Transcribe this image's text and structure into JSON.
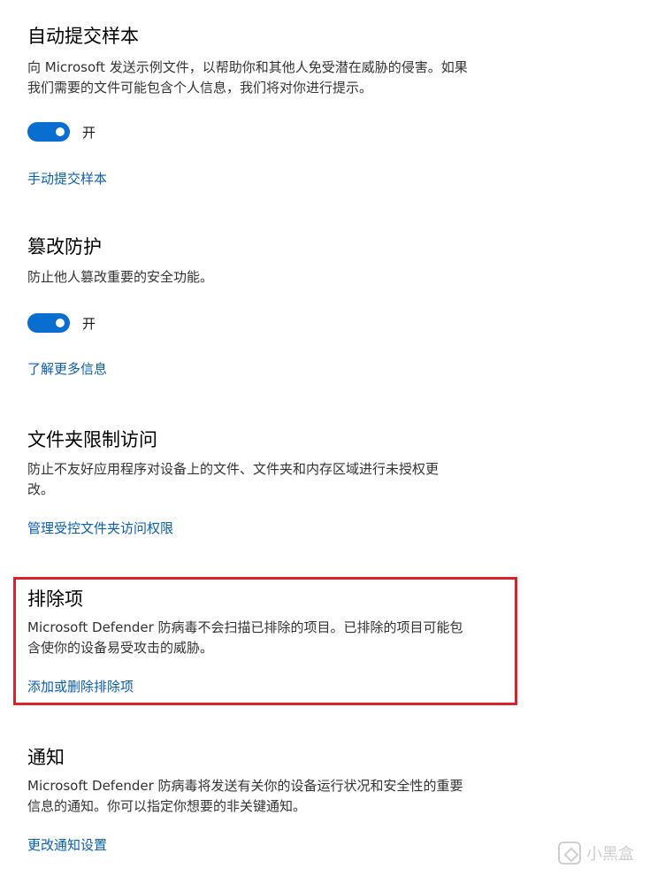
{
  "sections": [
    {
      "title": "自动提交样本",
      "desc_line1": "向 Microsoft 发送示例文件，以帮助你和其他人免受潜在威胁的侵害。如果",
      "desc_line2": "我们需要的文件可能包含个人信息，我们将对你进行提示。",
      "toggle_state": "开",
      "link": "手动提交样本"
    },
    {
      "title": "篡改防护",
      "desc_line1": "防止他人篡改重要的安全功能。",
      "toggle_state": "开",
      "link": "了解更多信息"
    },
    {
      "title": "文件夹限制访问",
      "desc_line1": "防止不友好应用程序对设备上的文件、文件夹和内存区域进行未授权更",
      "desc_line2": "改。",
      "link": "管理受控文件夹访问权限"
    },
    {
      "title": "排除项",
      "desc_line1": "Microsoft Defender 防病毒不会扫描已排除的项目。已排除的项目可能包",
      "desc_line2": "含使你的设备易受攻击的威胁。",
      "link": "添加或删除排除项"
    },
    {
      "title": "通知",
      "desc_line1": "Microsoft Defender 防病毒将发送有关你的设备运行状况和安全性的重要",
      "desc_line2": "信息的通知。你可以指定你想要的非关键通知。",
      "link": "更改通知设置"
    }
  ],
  "watermark": "小黑盒",
  "colors": {
    "toggle_on": "#0a6ed1",
    "link": "#0a5fb4",
    "highlight": "#d9222a"
  }
}
